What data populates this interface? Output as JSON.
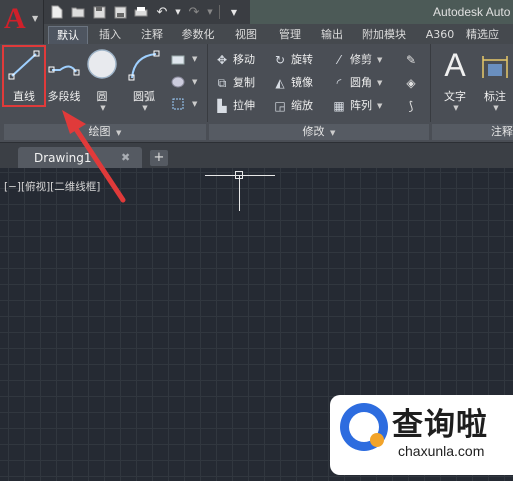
{
  "app": {
    "logo_letter": "A",
    "title": "Autodesk Auto"
  },
  "ribbon_tabs": [
    "默认",
    "插入",
    "注释",
    "参数化",
    "视图",
    "管理",
    "输出",
    "附加模块",
    "A360",
    "精选应"
  ],
  "draw_panel": {
    "tools": [
      {
        "label": "直线",
        "icon": "line-icon"
      },
      {
        "label": "多段线",
        "icon": "polyline-icon"
      },
      {
        "label": "圆",
        "icon": "circle-icon"
      },
      {
        "label": "圆弧",
        "icon": "arc-icon"
      }
    ],
    "footer": "绘图"
  },
  "modify_panel": {
    "rows": [
      [
        "移动",
        "旋转",
        "修剪"
      ],
      [
        "复制",
        "镜像",
        "圆角"
      ],
      [
        "拉伸",
        "缩放",
        "阵列"
      ]
    ],
    "footer": "修改"
  },
  "annotation_panel": {
    "tools": [
      {
        "label": "文字",
        "icon": "text-icon"
      },
      {
        "label": "标注",
        "icon": "dimension-icon"
      }
    ],
    "footer": "注释"
  },
  "file_tabs": {
    "active": "Drawing1",
    "close_glyph": "✖",
    "new_glyph": "+"
  },
  "viewport": {
    "label": "[−][俯视][二维线框]"
  },
  "watermark": {
    "title": "查询啦",
    "url": "chaxunla.com"
  },
  "colors": {
    "highlight": "#e03a3a",
    "canvas": "#252a33",
    "logo": "#d0202a"
  }
}
